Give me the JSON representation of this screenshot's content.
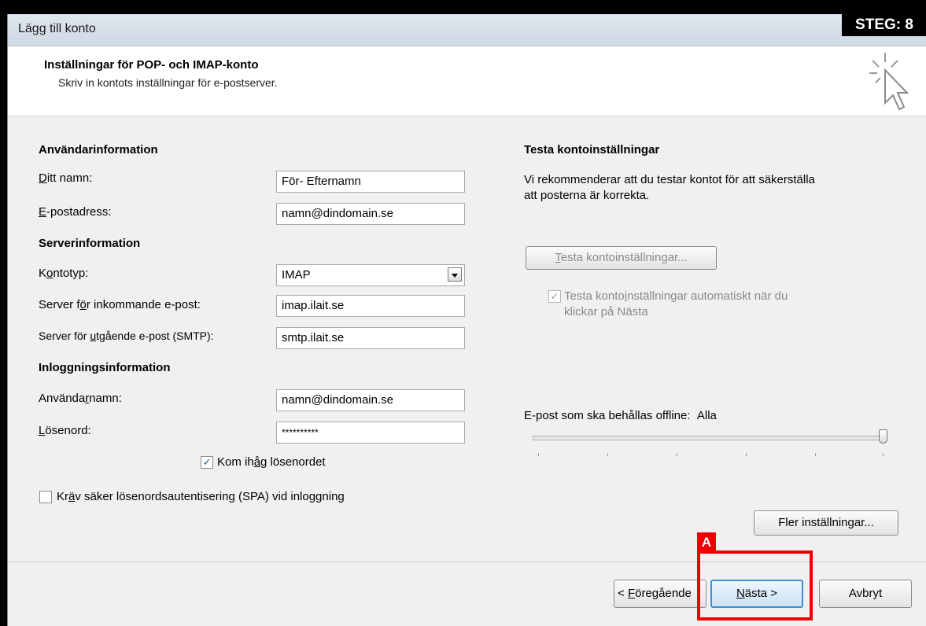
{
  "window": {
    "title": "Lägg till konto",
    "step_badge": "STEG: 8"
  },
  "header": {
    "title": "Inställningar för POP- och IMAP-konto",
    "subtitle": "Skriv in kontots inställningar för e-postserver."
  },
  "user_info": {
    "heading": "Användarinformation",
    "name_label_pre": "",
    "name_label_u": "D",
    "name_label_post": "itt namn:",
    "name_value": "För- Efternamn",
    "email_label_pre": "",
    "email_label_u": "E",
    "email_label_post": "-postadress:",
    "email_value": "namn@dindomain.se"
  },
  "server_info": {
    "heading": "Serverinformation",
    "type_label_pre": "K",
    "type_label_u": "o",
    "type_label_post": "ntotyp:",
    "type_value": "IMAP",
    "incoming_label_pre": "Server f",
    "incoming_label_u": "ö",
    "incoming_label_post": "r inkommande e-post:",
    "incoming_value": "imap.ilait.se",
    "outgoing_label_pre": "Server för ",
    "outgoing_label_u": "u",
    "outgoing_label_post": "tgående e-post (SMTP):",
    "outgoing_value": "smtp.ilait.se"
  },
  "login_info": {
    "heading": "Inloggningsinformation",
    "username_label_pre": "Använda",
    "username_label_u": "r",
    "username_label_post": "namn:",
    "username_value": "namn@dindomain.se",
    "password_label_pre": "",
    "password_label_u": "L",
    "password_label_post": "ösenord:",
    "password_value": "**********",
    "remember_pre": "Kom ih",
    "remember_u": "å",
    "remember_post": "g lösenordet",
    "remember_checked": "✓",
    "spa_pre": "Kr",
    "spa_u": "ä",
    "spa_post": "v säker lösenordsautentisering (SPA) vid inloggning"
  },
  "test": {
    "heading": "Testa kontoinställningar",
    "description_line1": "Vi rekommenderar att du testar kontot för att säkerställa",
    "description_line2": "att posterna är korrekta.",
    "button_u": "T",
    "button_post": "esta kontoinställningar...",
    "auto_pre": "Testa konto",
    "auto_u": "i",
    "auto_post": "nställningar automatiskt när du",
    "auto_line2": "klickar på Nästa",
    "auto_checked": "✓"
  },
  "offline": {
    "label": "E-post som ska behållas offline:",
    "value": "Alla",
    "slider_fraction": 1.0
  },
  "more_settings": {
    "pre": "Fler inställnin",
    "u": "g",
    "post": "ar..."
  },
  "nav": {
    "back_pre": "< ",
    "back_u": "F",
    "back_post": "öregående",
    "next_u": "N",
    "next_post": "ästa >",
    "cancel": "Avbryt"
  },
  "annotation": {
    "marker": "A",
    "color": "#e00000"
  },
  "icons": {
    "dropdown": "chevron-down-icon",
    "cursor": "cursor-sparkle-icon"
  }
}
